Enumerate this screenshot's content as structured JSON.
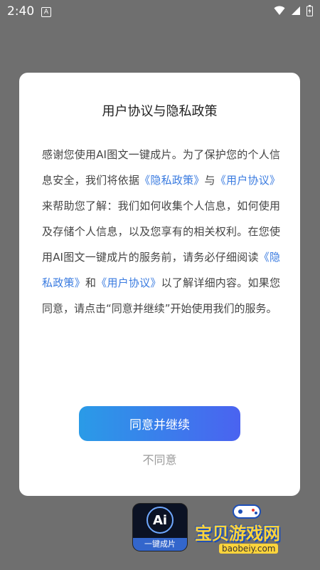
{
  "status_bar": {
    "time": "2:40",
    "notification_badge": "A"
  },
  "dialog": {
    "title": "用户协议与隐私政策",
    "body": {
      "t1": "感谢您使用AI图文一键成片。为了保护您的个人信息安全，我们将依据",
      "link_privacy_1": "《隐私政策》",
      "t2": "与",
      "link_agreement_1": "《用户协议》",
      "t3": "来帮助您了解：我们如何收集个人信息，如何使用及存储个人信息，以及您享有的相关权利。在您使用AI图文一键成片的服务前，请务必仔细阅读",
      "link_privacy_2": "《隐私政策》",
      "t4": "和",
      "link_agreement_2": "《用户协议》",
      "t5": "以了解详细内容。如果您同意，请点击“同意并继续”开始使用我们的服务。"
    },
    "agree_button": "同意并继续",
    "disagree_button": "不同意"
  },
  "app_icon": {
    "badge_text": "Ai",
    "caption": "一键成片"
  },
  "watermark": {
    "title": "宝贝游戏网",
    "url": "baobeiy.com"
  },
  "colors": {
    "link": "#3a7be0",
    "button_gradient_start": "#2a9be7",
    "button_gradient_end": "#4a63f0"
  }
}
